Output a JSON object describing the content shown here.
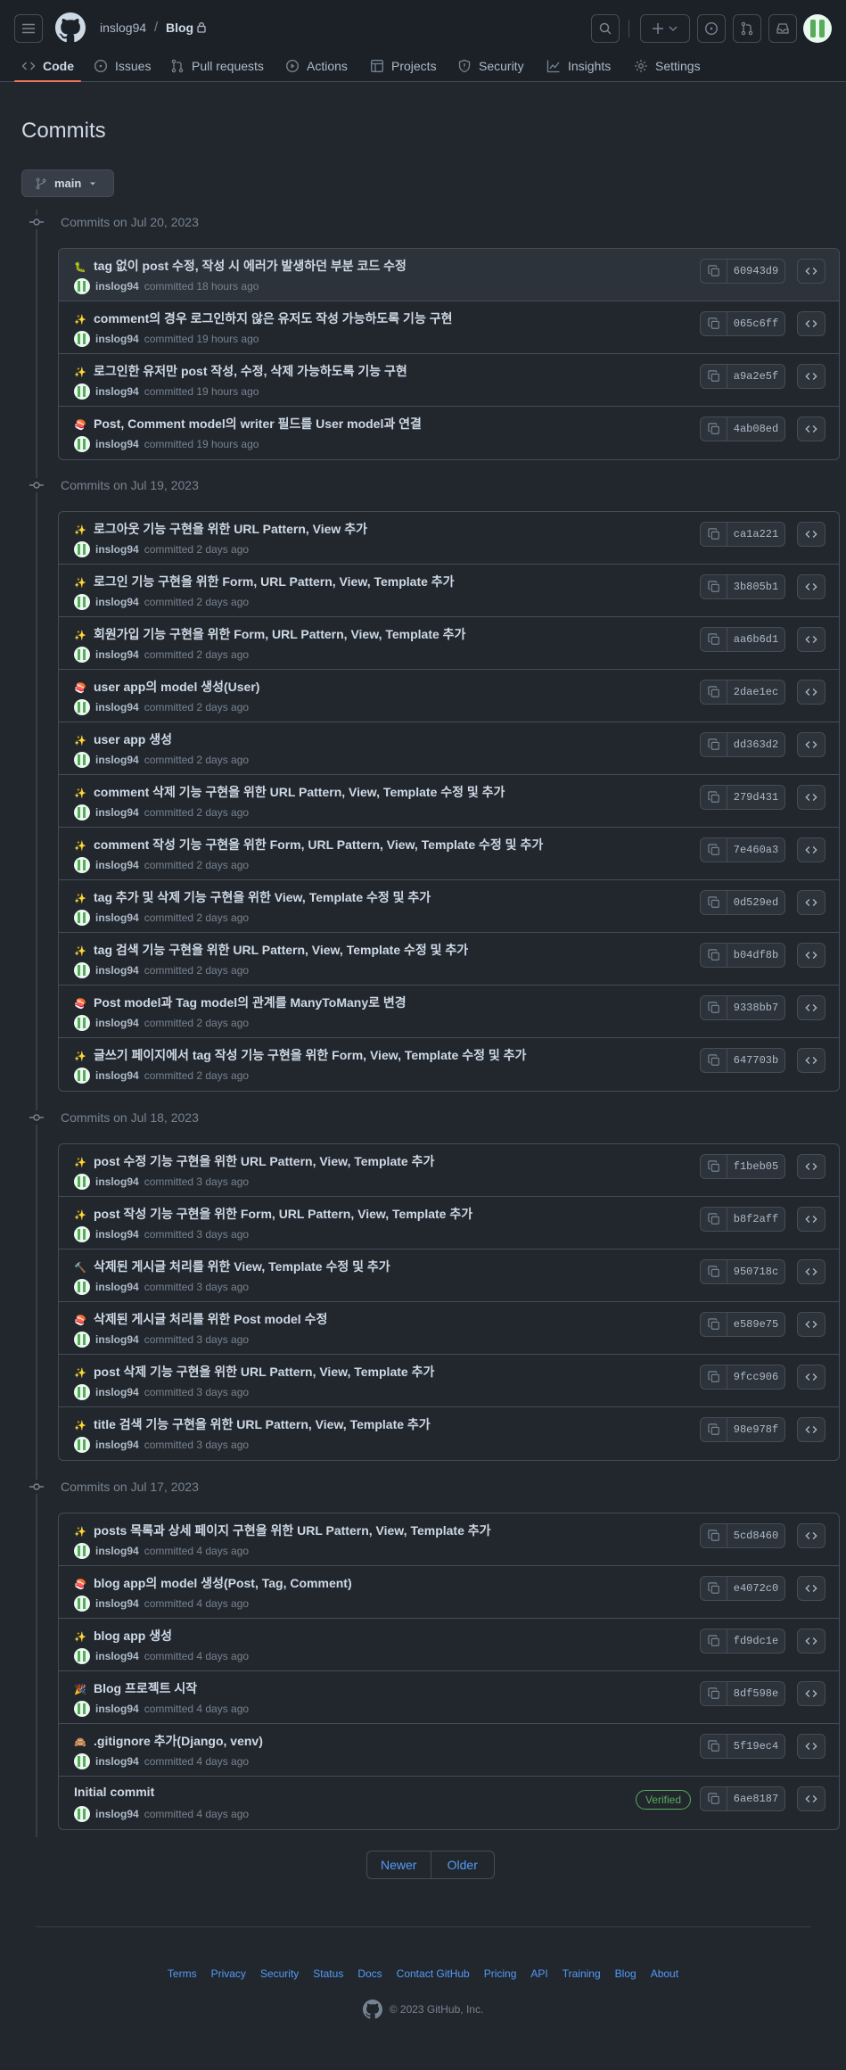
{
  "header": {
    "owner": "inslog94",
    "separator": "/",
    "repo": "Blog",
    "lock_icon": "lock-icon"
  },
  "nav": {
    "tabs": [
      {
        "label": "Code",
        "icon": "code-icon"
      },
      {
        "label": "Issues",
        "icon": "issue-icon"
      },
      {
        "label": "Pull requests",
        "icon": "pull-request-icon"
      },
      {
        "label": "Actions",
        "icon": "play-icon"
      },
      {
        "label": "Projects",
        "icon": "table-icon"
      },
      {
        "label": "Security",
        "icon": "shield-icon"
      },
      {
        "label": "Insights",
        "icon": "graph-icon"
      },
      {
        "label": "Settings",
        "icon": "gear-icon"
      }
    ]
  },
  "page": {
    "title": "Commits",
    "branch": "main"
  },
  "groups": [
    {
      "date": "Commits on Jul 20, 2023",
      "commits": [
        {
          "emoji": "🐛",
          "message": "tag 없이 post 수정, 작성 시 에러가 발생하던 부분 코드 수정",
          "author": "inslog94",
          "time": "committed 18 hours ago",
          "sha": "60943d9"
        },
        {
          "emoji": "✨",
          "message": "comment의 경우 로그인하지 않은 유저도 작성 가능하도록 기능 구현",
          "author": "inslog94",
          "time": "committed 19 hours ago",
          "sha": "065c6ff"
        },
        {
          "emoji": "✨",
          "message": "로그인한 유저만 post 작성, 수정, 삭제 가능하도록 기능 구현",
          "author": "inslog94",
          "time": "committed 19 hours ago",
          "sha": "a9a2e5f"
        },
        {
          "emoji": "🍣",
          "message": "Post, Comment model의 writer 필드를 User model과 연결",
          "author": "inslog94",
          "time": "committed 19 hours ago",
          "sha": "4ab08ed"
        }
      ]
    },
    {
      "date": "Commits on Jul 19, 2023",
      "commits": [
        {
          "emoji": "✨",
          "message": "로그아웃 기능 구현을 위한 URL Pattern, View 추가",
          "author": "inslog94",
          "time": "committed 2 days ago",
          "sha": "ca1a221"
        },
        {
          "emoji": "✨",
          "message": "로그인 기능 구현을 위한 Form, URL Pattern, View, Template 추가",
          "author": "inslog94",
          "time": "committed 2 days ago",
          "sha": "3b805b1"
        },
        {
          "emoji": "✨",
          "message": "회원가입 기능 구현을 위한 Form, URL Pattern, View, Template 추가",
          "author": "inslog94",
          "time": "committed 2 days ago",
          "sha": "aa6b6d1"
        },
        {
          "emoji": "🍣",
          "message": "user app의 model 생성(User)",
          "author": "inslog94",
          "time": "committed 2 days ago",
          "sha": "2dae1ec"
        },
        {
          "emoji": "✨",
          "message": "user app 생성",
          "author": "inslog94",
          "time": "committed 2 days ago",
          "sha": "dd363d2"
        },
        {
          "emoji": "✨",
          "message": "comment 삭제 기능 구현을 위한 URL Pattern, View, Template 수정 및 추가",
          "author": "inslog94",
          "time": "committed 2 days ago",
          "sha": "279d431"
        },
        {
          "emoji": "✨",
          "message": "comment 작성 기능 구현을 위한 Form, URL Pattern, View, Template 수정 및 추가",
          "author": "inslog94",
          "time": "committed 2 days ago",
          "sha": "7e460a3"
        },
        {
          "emoji": "✨",
          "message": "tag 추가 및 삭제 기능 구현을 위한 View, Template 수정 및 추가",
          "author": "inslog94",
          "time": "committed 2 days ago",
          "sha": "0d529ed"
        },
        {
          "emoji": "✨",
          "message": "tag 검색 기능 구현을 위한 URL Pattern, View, Template 수정 및 추가",
          "author": "inslog94",
          "time": "committed 2 days ago",
          "sha": "b04df8b"
        },
        {
          "emoji": "🍣",
          "message": "Post model과 Tag model의 관계를 ManyToMany로 변경",
          "author": "inslog94",
          "time": "committed 2 days ago",
          "sha": "9338bb7"
        },
        {
          "emoji": "✨",
          "message": "글쓰기 페이지에서 tag 작성 기능 구현을 위한 Form, View, Template 수정 및 추가",
          "author": "inslog94",
          "time": "committed 2 days ago",
          "sha": "647703b"
        }
      ]
    },
    {
      "date": "Commits on Jul 18, 2023",
      "commits": [
        {
          "emoji": "✨",
          "message": "post 수정 기능 구현을 위한 URL Pattern, View, Template 추가",
          "author": "inslog94",
          "time": "committed 3 days ago",
          "sha": "f1beb05"
        },
        {
          "emoji": "✨",
          "message": "post 작성 기능 구현을 위한 Form, URL Pattern, View, Template 추가",
          "author": "inslog94",
          "time": "committed 3 days ago",
          "sha": "b8f2aff"
        },
        {
          "emoji": "🔨",
          "message": "삭제된 게시글 처리를 위한 View, Template 수정 및 추가",
          "author": "inslog94",
          "time": "committed 3 days ago",
          "sha": "950718c"
        },
        {
          "emoji": "🍣",
          "message": "삭제된 게시글 처리를 위한 Post model 수정",
          "author": "inslog94",
          "time": "committed 3 days ago",
          "sha": "e589e75"
        },
        {
          "emoji": "✨",
          "message": "post 삭제 기능 구현을 위한 URL Pattern, View, Template 추가",
          "author": "inslog94",
          "time": "committed 3 days ago",
          "sha": "9fcc906"
        },
        {
          "emoji": "✨",
          "message": "title 검색 기능 구현을 위한 URL Pattern, View, Template 추가",
          "author": "inslog94",
          "time": "committed 3 days ago",
          "sha": "98e978f"
        }
      ]
    },
    {
      "date": "Commits on Jul 17, 2023",
      "commits": [
        {
          "emoji": "✨",
          "message": "posts 목록과 상세 페이지 구현을 위한 URL Pattern, View, Template 추가",
          "author": "inslog94",
          "time": "committed 4 days ago",
          "sha": "5cd8460"
        },
        {
          "emoji": "🍣",
          "message": "blog app의 model 생성(Post, Tag, Comment)",
          "author": "inslog94",
          "time": "committed 4 days ago",
          "sha": "e4072c0"
        },
        {
          "emoji": "✨",
          "message": "blog app 생성",
          "author": "inslog94",
          "time": "committed 4 days ago",
          "sha": "fd9dc1e"
        },
        {
          "emoji": "🎉",
          "message": "Blog 프로젝트 시작",
          "author": "inslog94",
          "time": "committed 4 days ago",
          "sha": "8df598e"
        },
        {
          "emoji": "🙈",
          "message": ".gitignore 추가(Django, venv)",
          "author": "inslog94",
          "time": "committed 4 days ago",
          "sha": "5f19ec4"
        },
        {
          "emoji": "",
          "message": "Initial commit",
          "author": "inslog94",
          "time": "committed 4 days ago",
          "sha": "6ae8187",
          "verified": "Verified"
        }
      ]
    }
  ],
  "pagination": {
    "newer": "Newer",
    "older": "Older"
  },
  "footer": {
    "links": [
      "Terms",
      "Privacy",
      "Security",
      "Status",
      "Docs",
      "Contact GitHub",
      "Pricing",
      "API",
      "Training",
      "Blog",
      "About"
    ],
    "copyright": "© 2023 GitHub, Inc."
  }
}
